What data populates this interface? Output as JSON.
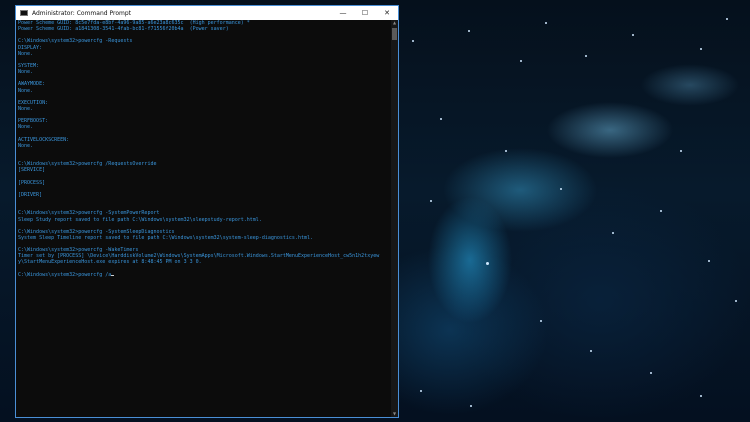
{
  "window": {
    "title": "Administrator: Command Prompt",
    "minimize": "—",
    "maximize": "☐",
    "close": "✕"
  },
  "console": {
    "lines": [
      "Power Scheme GUID: 8c5e7fda-e8bf-4a96-9a85-a6e23a8c635c  (High performance) *",
      "Power Scheme GUID: a1841308-3541-4fab-bc81-f71556f20b4a  (Power saver)",
      "",
      "C:\\Windows\\system32>powercfg -Requests",
      "DISPLAY:",
      "None.",
      "",
      "SYSTEM:",
      "None.",
      "",
      "AWAYMODE:",
      "None.",
      "",
      "EXECUTION:",
      "None.",
      "",
      "PERFBOOST:",
      "None.",
      "",
      "ACTIVELOCKSCREEN:",
      "None.",
      "",
      "",
      "C:\\Windows\\system32>powercfg /RequestsOverride",
      "[SERVICE]",
      "",
      "[PROCESS]",
      "",
      "[DRIVER]",
      "",
      "",
      "C:\\Windows\\system32>powercfg -SystemPowerReport",
      "Sleep Study report saved to file path C:\\Windows\\system32\\sleepstudy-report.html.",
      "",
      "C:\\Windows\\system32>powercfg -SystemSleepDiagnostics",
      "System Sleep Timeline report saved to file path C:\\Windows\\system32\\system-sleep-diagnostics.html.",
      "",
      "C:\\Windows\\system32>powercfg -WakeTimers",
      "Timer set by [PROCESS] \\Device\\HarddiskVolume2\\Windows\\SystemApps\\Microsoft.Windows.StartMenuExperienceHost_cw5n1h2txyew",
      "y\\StartMenuExperienceHost.exe expires at 8:48:45 PM on 3 3 0.",
      "",
      "C:\\Windows\\system32>powercfg /a"
    ]
  }
}
